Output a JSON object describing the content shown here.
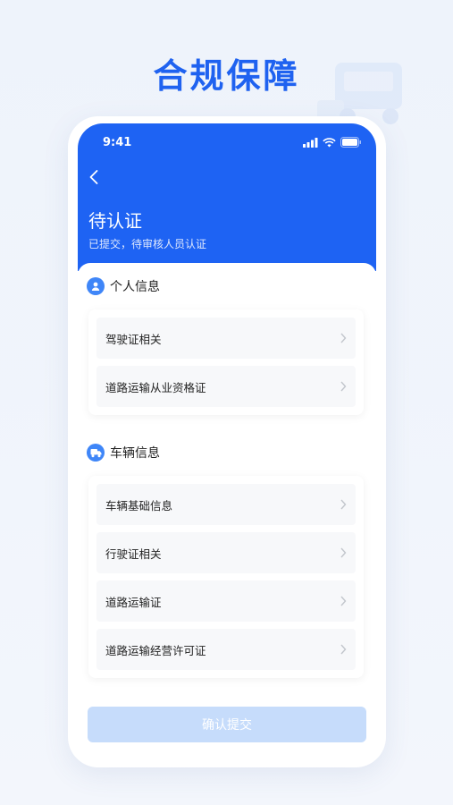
{
  "hero": {
    "title": "合规保障"
  },
  "status_bar": {
    "time": "9:41",
    "icons": [
      "signal-icon",
      "wifi-icon",
      "battery-icon"
    ]
  },
  "header": {
    "title": "待认证",
    "subtitle": "已提交，待审核人员认证"
  },
  "personal": {
    "title": "个人信息",
    "items": [
      {
        "label": "驾驶证相关"
      },
      {
        "label": "道路运输从业资格证"
      }
    ]
  },
  "vehicle": {
    "title": "车辆信息",
    "items": [
      {
        "label": "车辆基础信息"
      },
      {
        "label": "行驶证相关"
      },
      {
        "label": "道路运输证"
      },
      {
        "label": "道路运输经营许可证"
      }
    ]
  },
  "footer": {
    "confirm_label": "确认提交"
  },
  "colors": {
    "primary": "#1e63f3",
    "hero_text": "#1f62f0",
    "disabled_button": "#c6dcfb"
  }
}
